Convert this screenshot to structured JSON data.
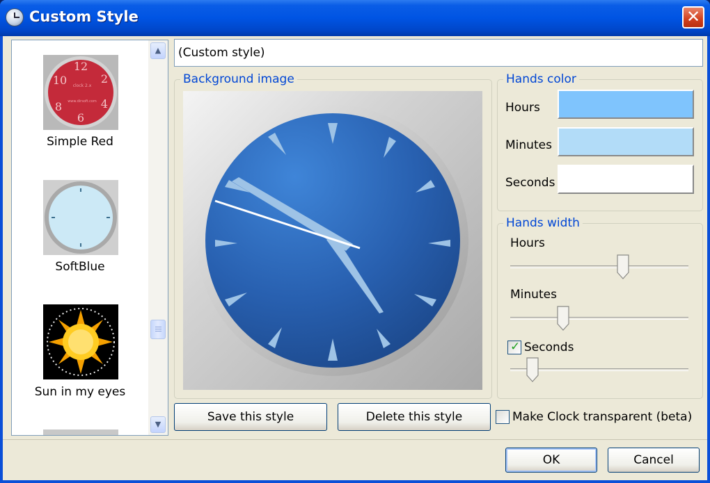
{
  "window": {
    "title": "Custom Style",
    "close_label": "✕"
  },
  "style_list": {
    "items": [
      {
        "label": "Simple Red"
      },
      {
        "label": "SoftBlue"
      },
      {
        "label": "Sun in my eyes"
      }
    ],
    "scroll_up": "▲",
    "scroll_down": "▼"
  },
  "style_name": {
    "value": "(Custom style)"
  },
  "background_group": {
    "legend": "Background image"
  },
  "thumbnail_text": {
    "simple_red": {
      "n12": "12",
      "n2": "2",
      "n4": "4",
      "n6": "6",
      "n8": "8",
      "n10": "10",
      "brand": "clock 2.x",
      "url": "www.dirsoft.com"
    }
  },
  "hands_color": {
    "legend": "Hands color",
    "rows": [
      {
        "label": "Hours",
        "color": "#7fc4fd"
      },
      {
        "label": "Minutes",
        "color": "#b2dcf8"
      },
      {
        "label": "Seconds",
        "color": "#ffffff"
      }
    ]
  },
  "hands_width": {
    "legend": "Hands width",
    "hours_label": "Hours",
    "hours_level": 0.64,
    "minutes_label": "Minutes",
    "minutes_level": 0.3,
    "seconds_label": "Seconds",
    "seconds_checked": true,
    "seconds_level": 0.12
  },
  "buttons": {
    "save": "Save this style",
    "delete": "Delete this style",
    "ok": "OK",
    "cancel": "Cancel"
  },
  "transparent": {
    "label": "Make Clock transparent (beta)",
    "checked": false
  },
  "colors": {
    "accent_blue": "#0046d5",
    "face_blue": "#2860b0",
    "titlebar": "#0054e3"
  }
}
